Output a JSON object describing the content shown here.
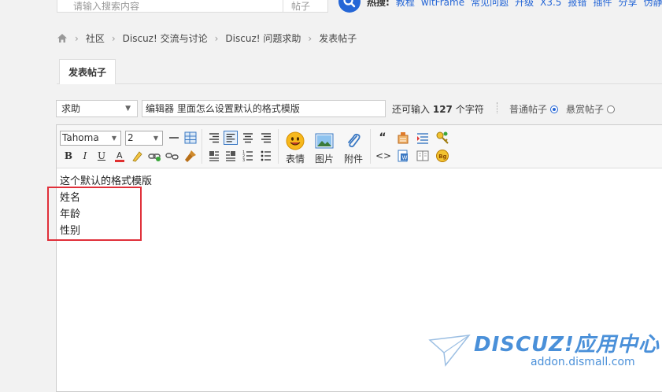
{
  "search": {
    "placeholder": "请输入搜索内容",
    "type_label": "帖子",
    "hot_label": "热搜:",
    "hot_keywords": [
      "教程",
      "witFrame",
      "常见问题",
      "升级",
      "X3.5",
      "报错",
      "插件",
      "分享",
      "伪静"
    ]
  },
  "breadcrumb": {
    "items": [
      "社区",
      "Discuz! 交流与讨论",
      "Discuz! 问题求助",
      "发表帖子"
    ],
    "separator": "›"
  },
  "tabs": {
    "active": "发表帖子"
  },
  "post_form": {
    "thread_type": "求助",
    "subject": "编辑器 里面怎么设置默认的格式模版",
    "remaining_prefix": "还可输入",
    "remaining_count": "127",
    "remaining_suffix": "个字符",
    "radio_normal": "普通帖子",
    "radio_reward": "悬赏帖子",
    "normal_selected": true
  },
  "toolbar": {
    "font": "Tahoma",
    "size": "2",
    "bold": "B",
    "italic": "I",
    "underline": "U",
    "emoji_label": "表情",
    "image_label": "图片",
    "attach_label": "附件",
    "quote": "“",
    "code": "<>"
  },
  "editor": {
    "lines": [
      "这个默认的格式模版",
      "姓名",
      "年龄",
      "性别"
    ],
    "highlight_color": "#e0303a"
  },
  "watermark": {
    "brand": "DISCUZ!应用中心",
    "url": "addon.dismall.com"
  },
  "colors": {
    "accent": "#2566d6",
    "watermark": "#4a90d9"
  }
}
